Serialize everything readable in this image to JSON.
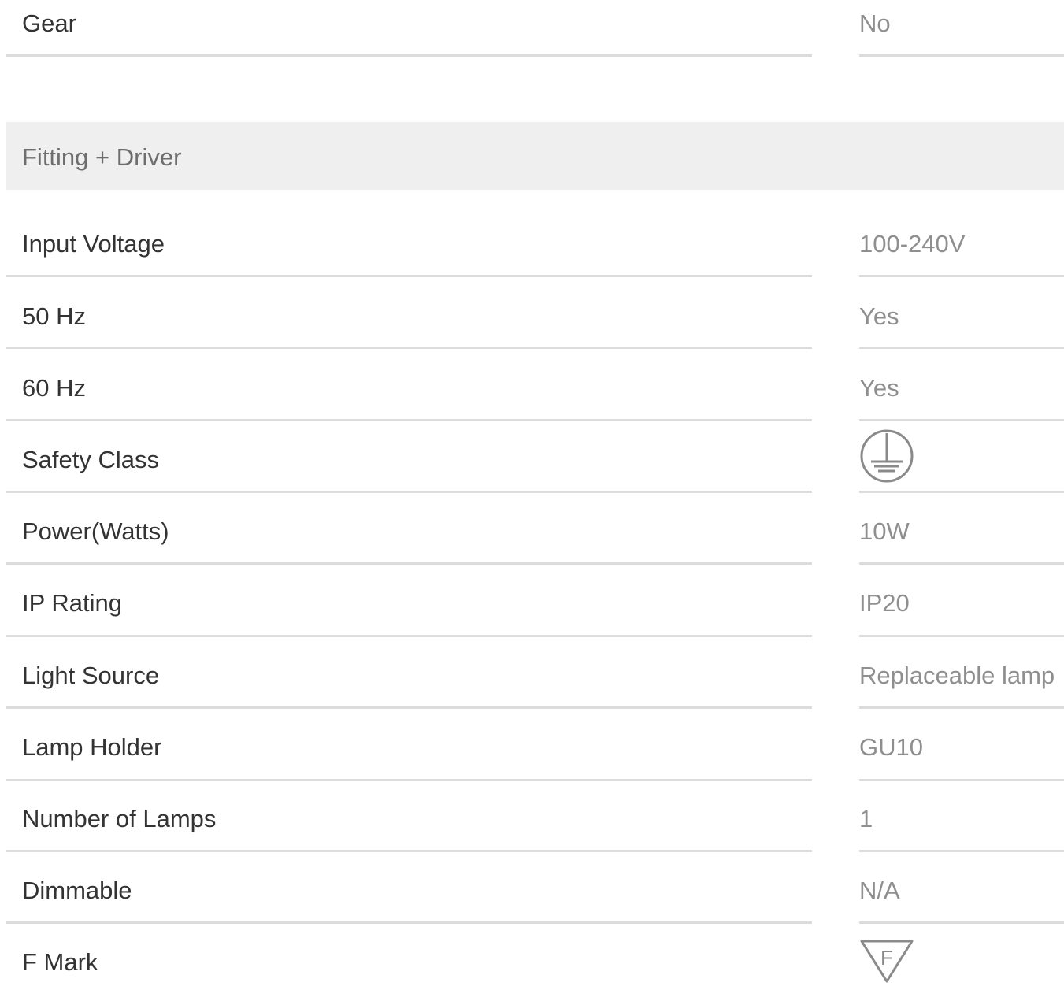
{
  "gear": {
    "label": "Gear",
    "value": "No"
  },
  "section": {
    "title": "Fitting + Driver"
  },
  "rows": [
    {
      "label": "Input Voltage",
      "value": "100-240V"
    },
    {
      "label": "50 Hz",
      "value": "Yes"
    },
    {
      "label": "60 Hz",
      "value": "Yes"
    },
    {
      "label": "Safety Class",
      "icon": "earth-ground-class-1-icon"
    },
    {
      "label": "Power(Watts)",
      "value": "10W"
    },
    {
      "label": "IP Rating",
      "value": "IP20"
    },
    {
      "label": "Light Source",
      "value": "Replaceable lamp"
    },
    {
      "label": "Lamp Holder",
      "value": "GU10"
    },
    {
      "label": "Number of Lamps",
      "value": "1"
    },
    {
      "label": "Dimmable",
      "value": "N/A"
    },
    {
      "label": "F Mark",
      "icon": "f-mark-triangle-icon",
      "icon_text": "F"
    }
  ],
  "colors": {
    "label": "#333333",
    "value": "#8f8f8f",
    "rule": "#dcdcdc",
    "section_bg": "#efefef",
    "icon_stroke": "#8a8a8a"
  }
}
